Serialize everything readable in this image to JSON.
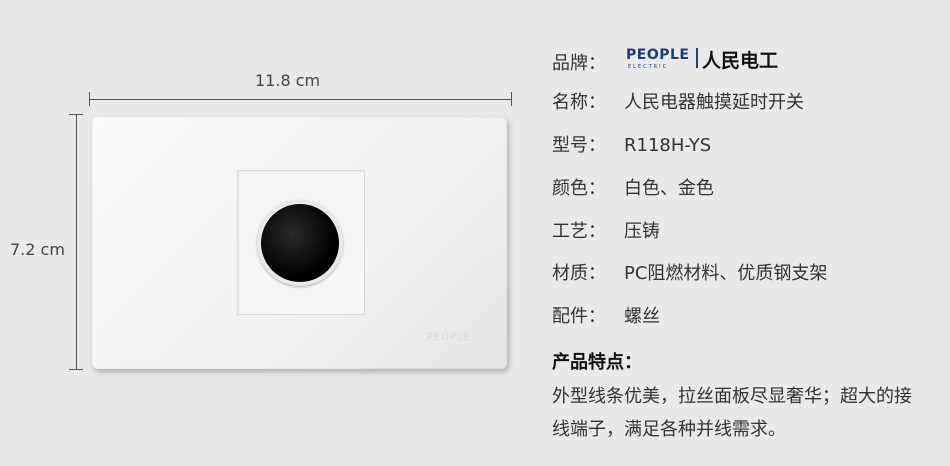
{
  "dimensions": {
    "width_label": "11.8 cm",
    "height_label": "7.2 cm"
  },
  "product_image": {
    "plate_watermark": "PEOPLE"
  },
  "brand": {
    "label": "品牌：",
    "logo_en": "PEOPLE",
    "logo_en_sub": "ELECTRIC",
    "logo_cn": "人民电工"
  },
  "specs": [
    {
      "label": "名称：",
      "value": "人民电器触摸延时开关"
    },
    {
      "label": "型号：",
      "value": "R118H-YS"
    },
    {
      "label": "颜色：",
      "value": "白色、金色"
    },
    {
      "label": "工艺：",
      "value": "压铸"
    },
    {
      "label": "材质：",
      "value": "PC阻燃材料、优质钢支架"
    },
    {
      "label": "配件：",
      "value": "螺丝"
    }
  ],
  "features": {
    "title": "产品特点：",
    "text": "外型线条优美，拉丝面板尽显奢华；超大的接线端子，满足各种并线需求。"
  }
}
